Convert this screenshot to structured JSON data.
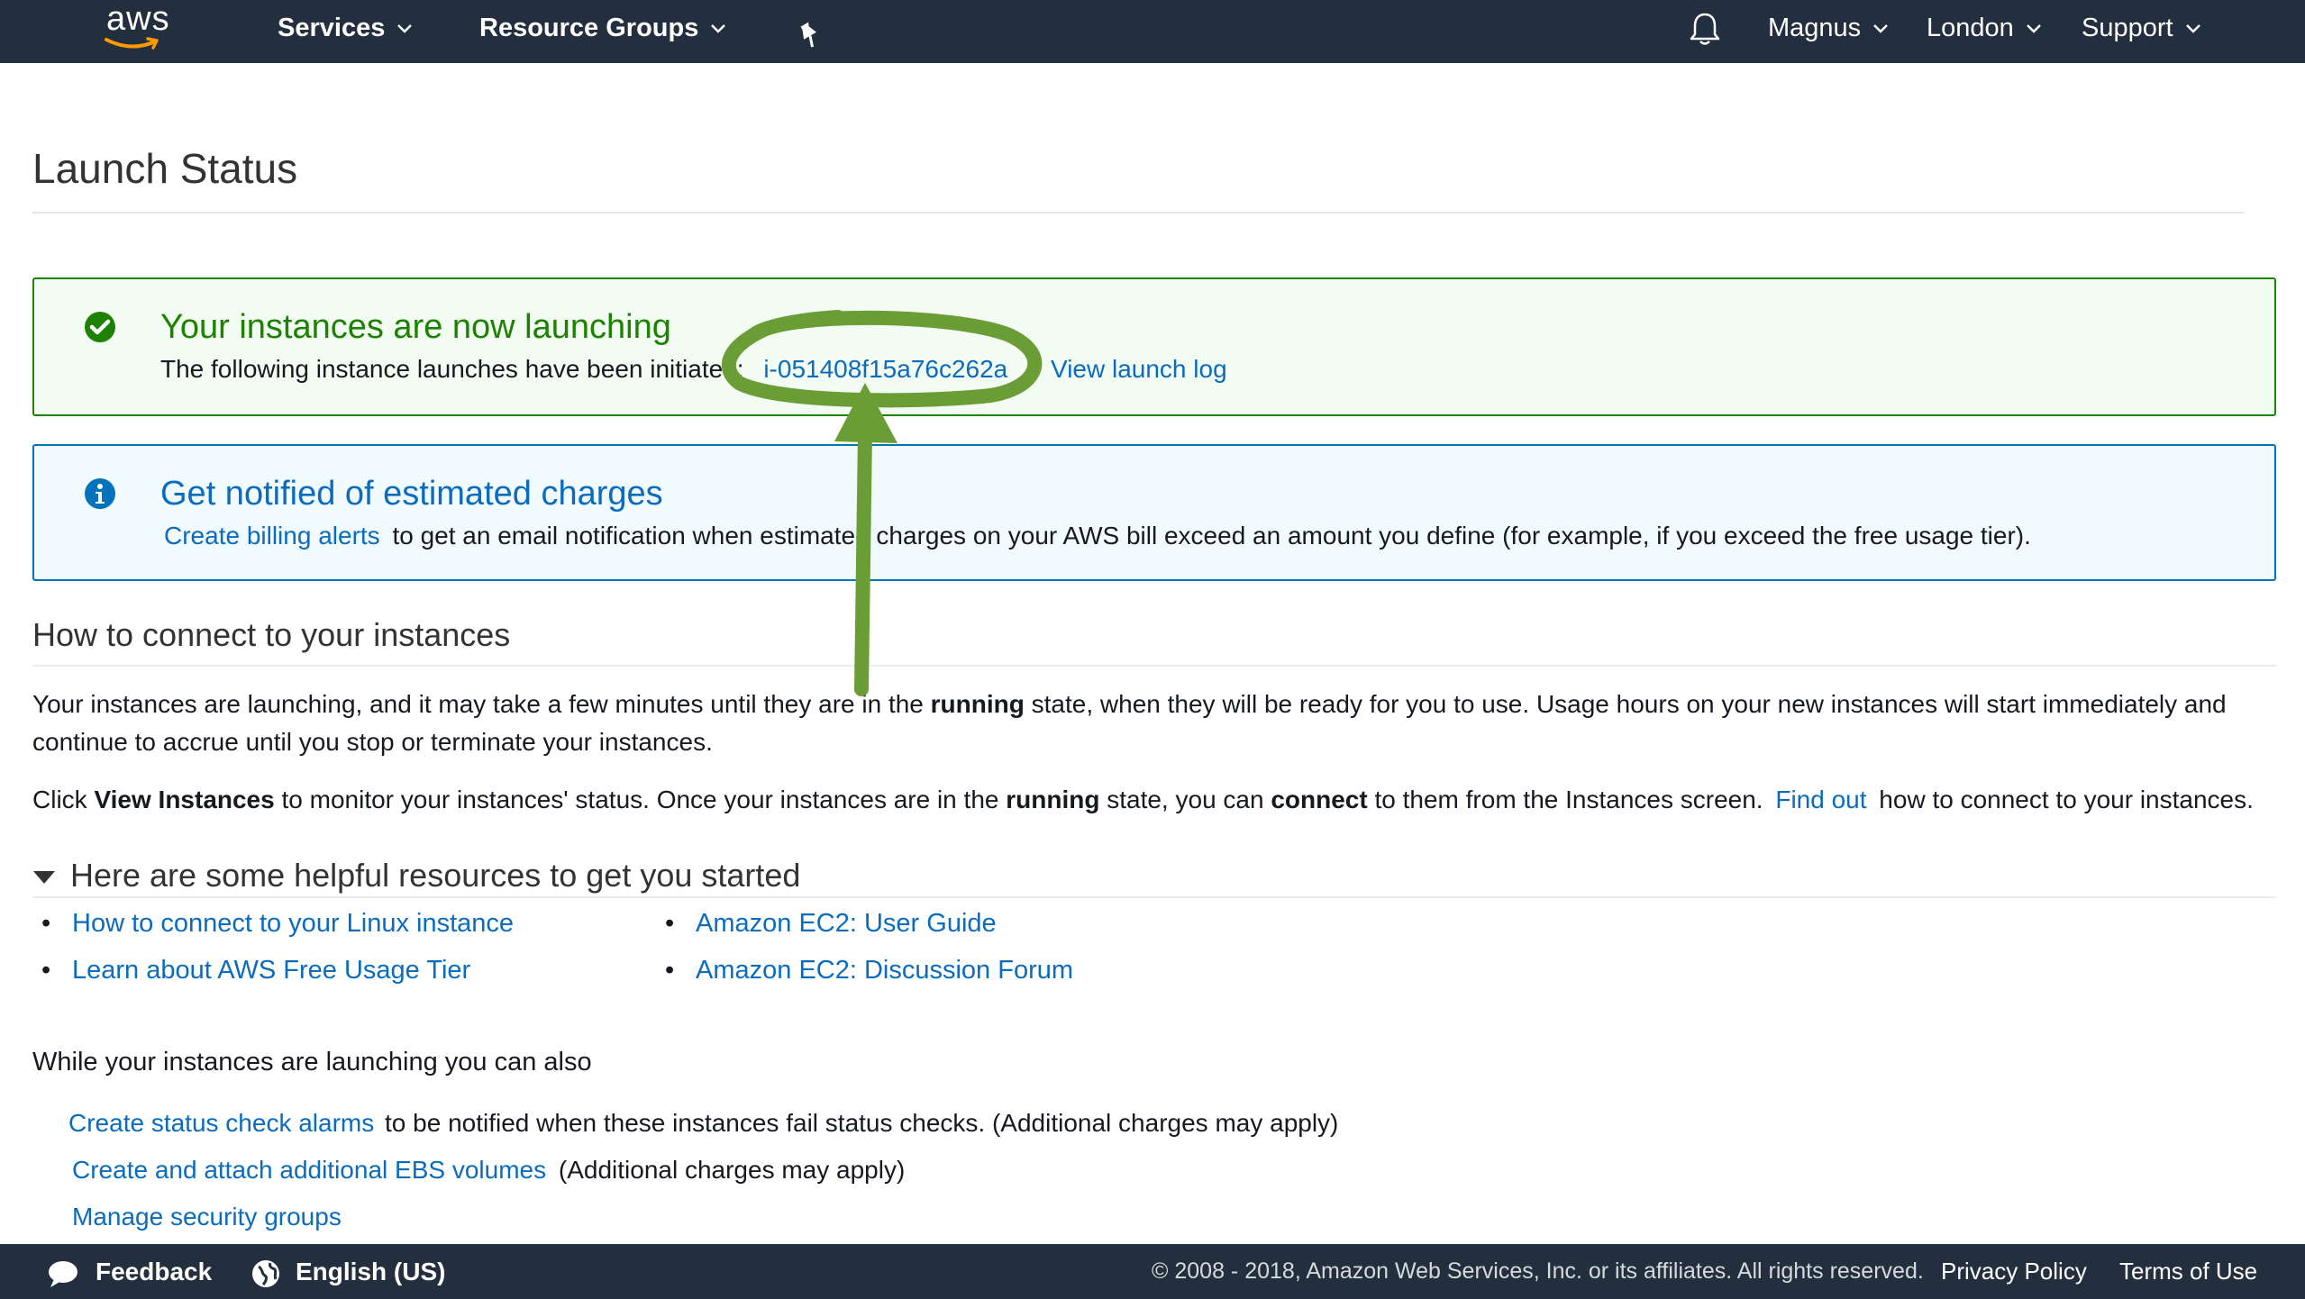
{
  "topnav": {
    "logo_text": "aws",
    "services": "Services",
    "resource_groups": "Resource Groups",
    "user": "Magnus",
    "region": "London",
    "support": "Support"
  },
  "page": {
    "title": "Launch Status"
  },
  "success_alert": {
    "heading": "Your instances are now launching",
    "body_text": "The following instance launches have been initiated:",
    "instance_id": "i-051408f15a76c262a",
    "view_log": "View launch log"
  },
  "info_alert": {
    "heading": "Get notified of estimated charges",
    "link": "Create billing alerts",
    "body_text": "to get an email notification when estimated charges on your AWS bill exceed an amount you define (for example, if you exceed the free usage tier)."
  },
  "connect": {
    "heading": "How to connect to your instances",
    "p1_a": "Your instances are launching, and it may take a few minutes until they are in the ",
    "p1_bold": "running",
    "p1_b": " state, when they will be ready for you to use. Usage hours on your new instances will start immediately and continue to accrue until you stop or terminate your instances.",
    "p2_a": "Click ",
    "p2_bold1": "View Instances",
    "p2_b": " to monitor your instances' status. Once your instances are in the ",
    "p2_bold2": "running",
    "p2_c": " state, you can ",
    "p2_bold3": "connect",
    "p2_d": " to them from the Instances screen. ",
    "p2_link": "Find out",
    "p2_e": " how to connect to your instances."
  },
  "resources": {
    "heading": "Here are some helpful resources to get you started",
    "left": [
      "How to connect to your Linux instance",
      "Learn about AWS Free Usage Tier"
    ],
    "right": [
      "Amazon EC2: User Guide",
      "Amazon EC2: Discussion Forum"
    ]
  },
  "also": {
    "heading": "While your instances are launching you can also",
    "line1_link": "Create status check alarms",
    "line1_text": "to be notified when these instances fail status checks. (Additional charges may apply)",
    "line2_link": "Create and attach additional EBS volumes",
    "line2_text": "(Additional charges may apply)",
    "line3_link": "Manage security groups"
  },
  "footer": {
    "feedback": "Feedback",
    "language": "English (US)",
    "copyright": "© 2008 - 2018, Amazon Web Services, Inc. or its affiliates. All rights reserved.",
    "privacy": "Privacy Policy",
    "terms": "Terms of Use"
  },
  "colors": {
    "nav_bg": "#232f3e",
    "success": "#1d8102",
    "info": "#0073bb",
    "link": "#0b6bbd",
    "annotation": "#6a9d35"
  },
  "icons": {
    "success": "check-circle-icon",
    "info": "info-circle-icon",
    "bell": "bell-icon",
    "pin": "pin-icon",
    "feedback": "speech-bubble-icon",
    "language": "globe-icon"
  }
}
